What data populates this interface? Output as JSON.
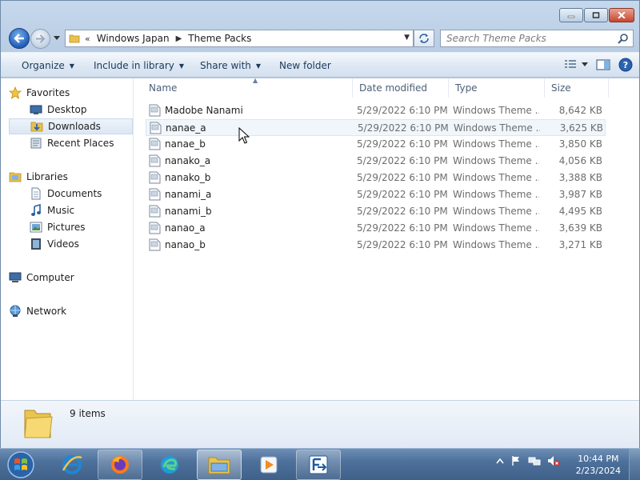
{
  "window": {
    "controls": {
      "minimize": "minimize",
      "maximize": "maximize",
      "close": "close"
    }
  },
  "address_bar": {
    "overflow_chevron": "«",
    "crumbs": [
      "Windows Japan",
      "Theme Packs"
    ],
    "separator": "▶",
    "search_placeholder": "Search Theme Packs"
  },
  "toolbar": {
    "organize": "Organize",
    "include_in_library": "Include in library",
    "share_with": "Share with",
    "new_folder": "New folder",
    "dropdown_arrow": "▼"
  },
  "nav": {
    "favorites": "Favorites",
    "desktop": "Desktop",
    "downloads": "Downloads",
    "recent_places": "Recent Places",
    "libraries": "Libraries",
    "documents": "Documents",
    "music": "Music",
    "pictures": "Pictures",
    "videos": "Videos",
    "computer": "Computer",
    "network": "Network"
  },
  "columns": {
    "name": "Name",
    "date_modified": "Date modified",
    "type": "Type",
    "size": "Size",
    "sort_indicator": "▲"
  },
  "files": [
    {
      "name": "Madobe Nanami",
      "date": "5/29/2022 6:10 PM",
      "type": "Windows Theme ...",
      "size": "8,642 KB"
    },
    {
      "name": "nanae_a",
      "date": "5/29/2022 6:10 PM",
      "type": "Windows Theme ...",
      "size": "3,625 KB"
    },
    {
      "name": "nanae_b",
      "date": "5/29/2022 6:10 PM",
      "type": "Windows Theme ...",
      "size": "3,850 KB"
    },
    {
      "name": "nanako_a",
      "date": "5/29/2022 6:10 PM",
      "type": "Windows Theme ...",
      "size": "4,056 KB"
    },
    {
      "name": "nanako_b",
      "date": "5/29/2022 6:10 PM",
      "type": "Windows Theme ...",
      "size": "3,388 KB"
    },
    {
      "name": "nanami_a",
      "date": "5/29/2022 6:10 PM",
      "type": "Windows Theme ...",
      "size": "3,987 KB"
    },
    {
      "name": "nanami_b",
      "date": "5/29/2022 6:10 PM",
      "type": "Windows Theme ...",
      "size": "4,495 KB"
    },
    {
      "name": "nanao_a",
      "date": "5/29/2022 6:10 PM",
      "type": "Windows Theme ...",
      "size": "3,639 KB"
    },
    {
      "name": "nanao_b",
      "date": "5/29/2022 6:10 PM",
      "type": "Windows Theme ...",
      "size": "3,271 KB"
    }
  ],
  "details": {
    "item_count": "9 items"
  },
  "taskbar": {
    "apps": [
      "internet-explorer",
      "firefox",
      "edge",
      "file-explorer",
      "media-player",
      "app-launcher"
    ],
    "clock_time": "10:44 PM",
    "clock_date": "2/23/2024"
  },
  "colors": {
    "accent": "#3e6089",
    "selection": "#dce7f4",
    "hover_row": "#f0f6fc"
  }
}
